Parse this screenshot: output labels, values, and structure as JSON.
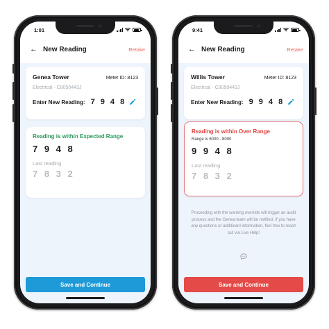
{
  "colors": {
    "accent_blue": "#1e9ad8",
    "accent_red": "#e34a48",
    "ok_green": "#2b9a5c",
    "over_red": "#e0423f",
    "retake": "#e76a63"
  },
  "phones": [
    {
      "status": {
        "time": "1:01"
      },
      "header": {
        "back_icon": "back-arrow-icon",
        "title": "New Reading",
        "retake_label": "Retake"
      },
      "meter": {
        "building": "Genea Tower",
        "meter_id": "Meter ID: 8123",
        "subtitle": "Electrical - C8050443J",
        "entry_label": "Enter New Reading:",
        "entry_value": "7 9 4 8",
        "edit_icon": "pencil-icon"
      },
      "result": {
        "status_title": "Reading is within Expected Range",
        "current_value": "7 9 4 8",
        "last_label": "Last reading",
        "last_value": "7 8 3 2"
      },
      "cta_label": "Save and Continue"
    },
    {
      "status": {
        "time": "9:41"
      },
      "header": {
        "back_icon": "back-arrow-icon",
        "title": "New Reading",
        "retake_label": "Retake"
      },
      "meter": {
        "building": "Willis Tower",
        "meter_id": "Meter ID: 8123",
        "subtitle": "Electrical - C8050443J",
        "entry_label": "Enter New Reading:",
        "entry_value": "9 9 4 8",
        "edit_icon": "pencil-icon"
      },
      "result": {
        "status_title": "Reading is within Over Range",
        "range_text": "Range is 6000 - 8000",
        "current_value": "9 9 4 8",
        "last_label": "Last reading",
        "last_value": "7 8 3 2"
      },
      "warning_note": "Proceeding with the warning override will trigger an audit process and the Genea team will be notified. If you have any questions or additioanl information, feel free to reach out via Live Help!",
      "chat_icon": "chat-bubble-icon",
      "cta_label": "Save and Continue"
    }
  ]
}
